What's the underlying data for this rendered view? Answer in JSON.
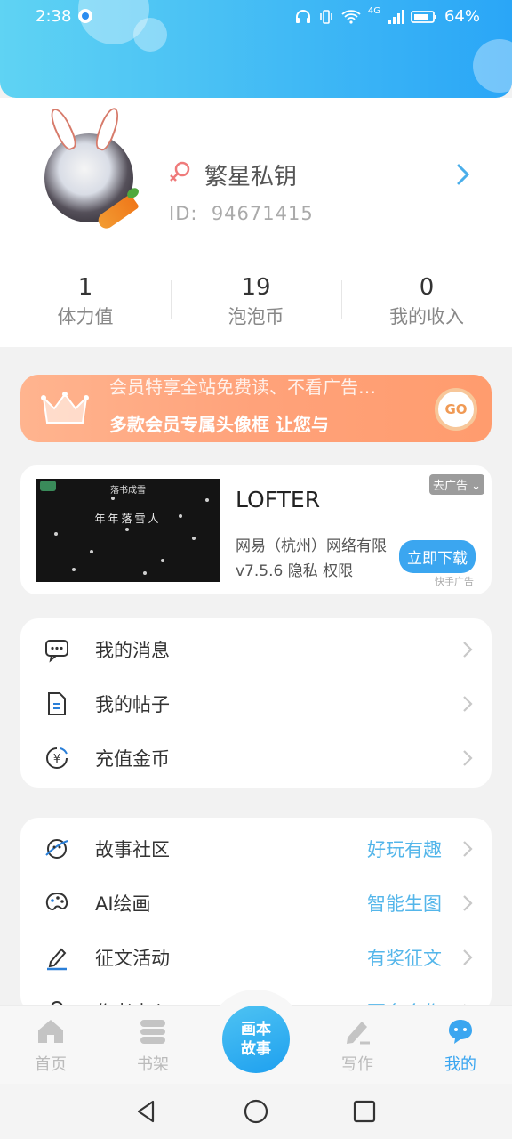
{
  "status_bar": {
    "time": "2:38",
    "network": "4G",
    "battery": "64%"
  },
  "profile": {
    "username": "繁星私钥",
    "id_label": "ID:",
    "id_value": "94671415",
    "gender_icon": "female-icon",
    "avatar_icon": "avatar-image"
  },
  "stats": [
    {
      "value": "1",
      "label": "体力值"
    },
    {
      "value": "19",
      "label": "泡泡币"
    },
    {
      "value": "0",
      "label": "我的收入"
    }
  ],
  "vip_banner": {
    "line1": "会员特享全站免费读、不看广告…",
    "line2": "多款会员专属头像框  让您与",
    "go_label": "GO"
  },
  "ad": {
    "remove_label": "去广告",
    "title": "LOFTER",
    "company": "网易（杭州）网络有限公司",
    "version_line": "v7.5.6 隐私 权限",
    "download_label": "立即下载",
    "source": "快手广告",
    "image_caption_top": "落书成雪",
    "image_caption_mid": "年年落雪人"
  },
  "menu1": [
    {
      "label": "我的消息",
      "icon": "message-icon"
    },
    {
      "label": "我的帖子",
      "icon": "document-icon"
    },
    {
      "label": "充值金币",
      "icon": "coin-icon"
    }
  ],
  "menu2": [
    {
      "label": "故事社区",
      "extra": "好玩有趣",
      "icon": "planet-icon"
    },
    {
      "label": "AI绘画",
      "extra": "智能生图",
      "icon": "palette-icon"
    },
    {
      "label": "征文活动",
      "extra": "有奖征文",
      "icon": "pen-icon"
    },
    {
      "label": "作者中心",
      "extra": "更多合作",
      "icon": "author-icon"
    }
  ],
  "tabbar": {
    "tabs": [
      {
        "label": "首页",
        "icon": "home-icon"
      },
      {
        "label": "书架",
        "icon": "bookshelf-icon"
      },
      {
        "label": "写作",
        "icon": "write-icon"
      },
      {
        "label": "我的",
        "icon": "profile-chat-icon"
      }
    ],
    "center_line1": "画本",
    "center_line2": "故事"
  },
  "colors": {
    "accent": "#3ba6f0",
    "vip_gradient_start": "#ffb48f",
    "extra_text": "#54b6ea"
  }
}
